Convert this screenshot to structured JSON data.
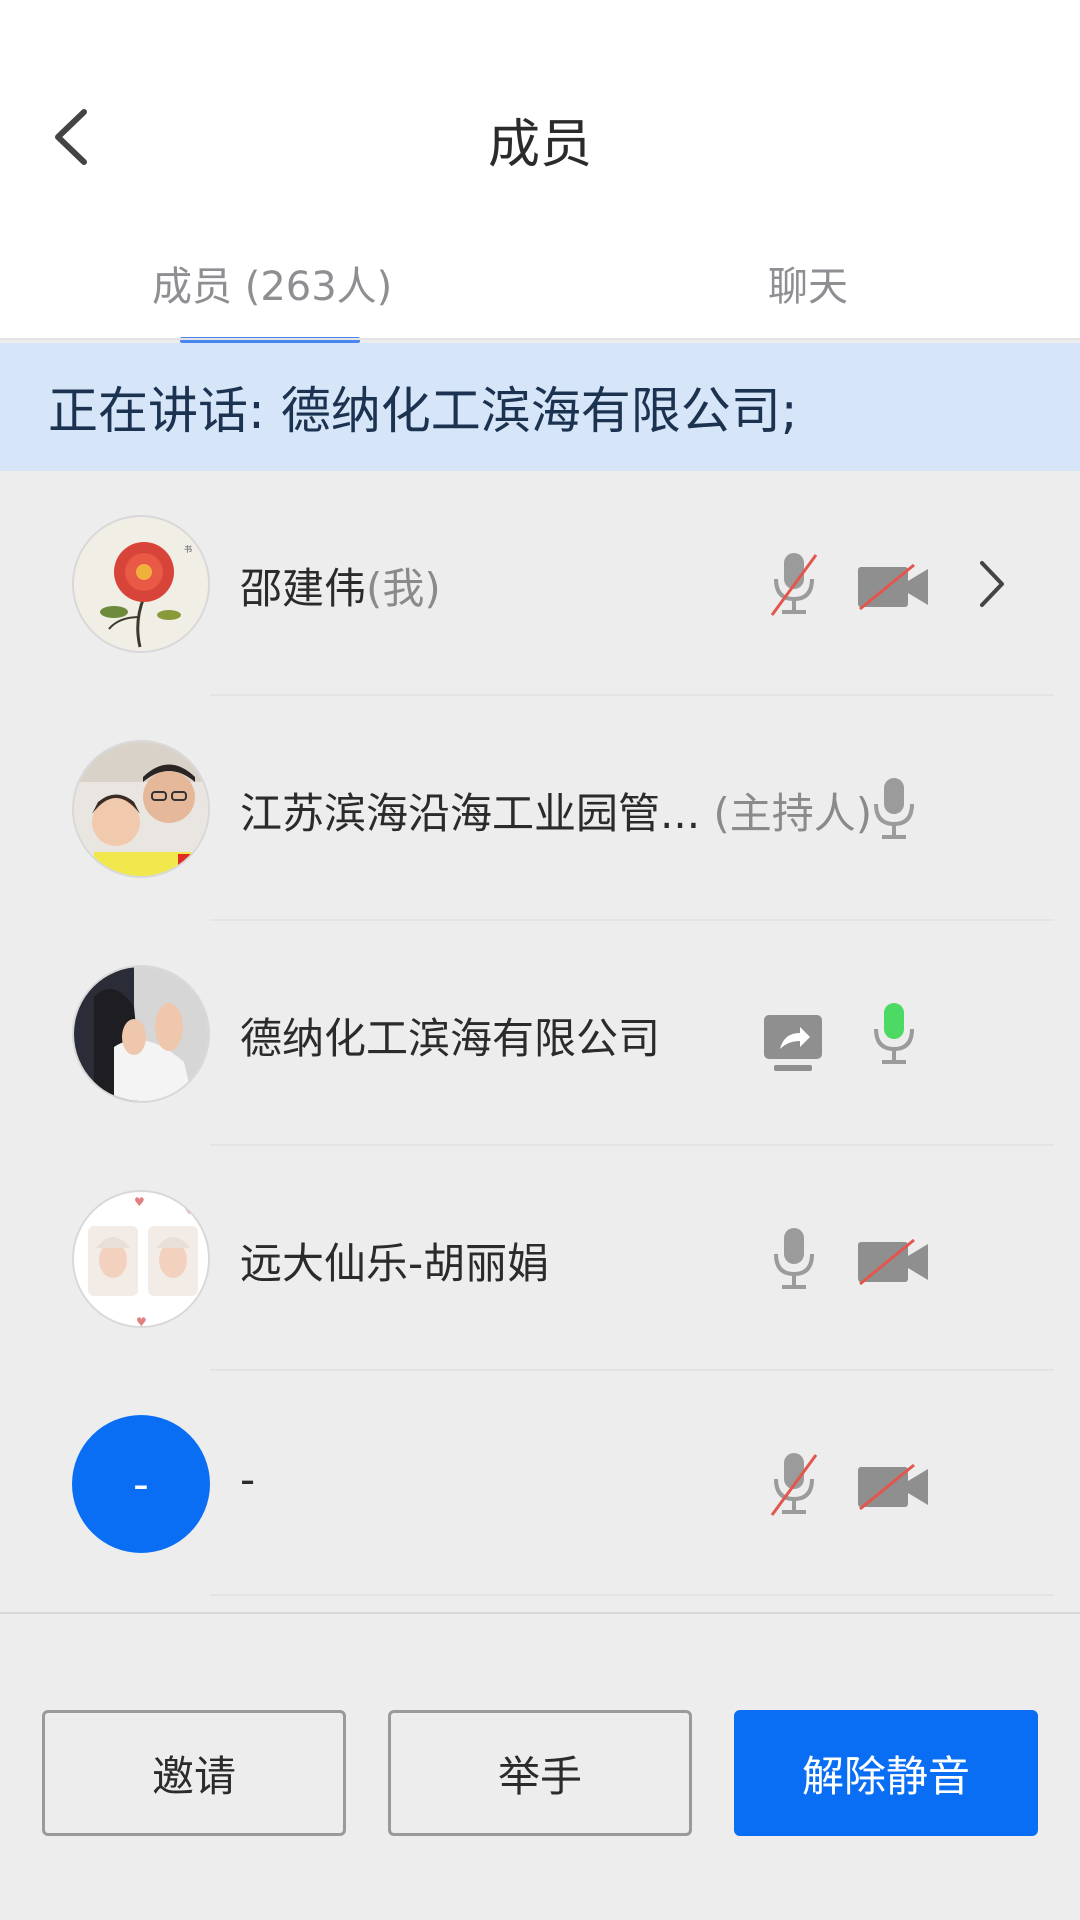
{
  "header": {
    "title": "成员"
  },
  "tabs": [
    {
      "label": "成员 (263人)"
    },
    {
      "label": "聊天"
    }
  ],
  "speaking": {
    "text": "正在讲话: 德纳化工滨海有限公司;"
  },
  "members": [
    {
      "name": "邵建伟",
      "tag": "(我)"
    },
    {
      "name": "江苏滨海沿海工业园管...",
      "tag": "(主持人)"
    },
    {
      "name": "德纳化工滨海有限公司",
      "tag": ""
    },
    {
      "name": "远大仙乐-胡丽娟",
      "tag": ""
    },
    {
      "name": "-",
      "tag": "",
      "avatar_text": "-"
    }
  ],
  "buttons": {
    "invite": "邀请",
    "raise_hand": "举手",
    "unmute": "解除静音"
  },
  "colors": {
    "accent": "#0a6ef5",
    "banner_bg": "#d6e6f8",
    "mic_active": "#4cd964",
    "muted_slash": "#e2564d"
  }
}
